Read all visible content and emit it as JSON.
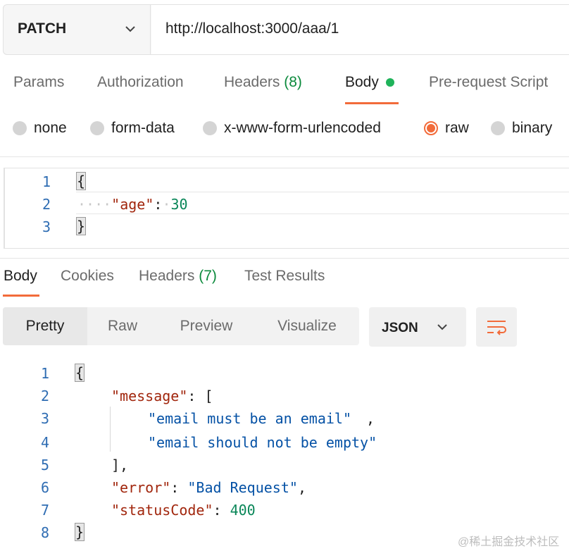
{
  "request": {
    "method": "PATCH",
    "method_icon": "chevron-down-icon",
    "url": "http://localhost:3000/aaa/1"
  },
  "request_tabs": {
    "params": "Params",
    "authorization": "Authorization",
    "headers_label": "Headers",
    "headers_count": "(8)",
    "body": "Body",
    "prerequest": "Pre-request Script"
  },
  "body_types": {
    "none": "none",
    "form_data": "form-data",
    "urlencoded": "x-www-form-urlencoded",
    "raw": "raw",
    "binary": "binary",
    "selected": "raw"
  },
  "request_body": {
    "lines": [
      "1",
      "2",
      "3"
    ],
    "open_brace": "{",
    "key": "\"age\"",
    "colon": ":",
    "value": "30",
    "close_brace": "}",
    "indent_marks": "····",
    "space_mark": "·"
  },
  "response_tabs": {
    "body": "Body",
    "cookies": "Cookies",
    "headers_label": "Headers",
    "headers_count": "(7)",
    "test_results": "Test Results"
  },
  "view_modes": {
    "pretty": "Pretty",
    "raw": "Raw",
    "preview": "Preview",
    "visualize": "Visualize",
    "format": "JSON",
    "wrap_icon": "wrap-lines-icon"
  },
  "response_body": {
    "lines": [
      "1",
      "2",
      "3",
      "4",
      "5",
      "6",
      "7",
      "8"
    ],
    "open_brace": "{",
    "message_key": "\"message\"",
    "message_open": ": [",
    "msg1": "\"email must be an email\"",
    "msg2": "\"email should not be empty\"",
    "array_close": "],",
    "error_key": "\"error\"",
    "error_value": "\"Bad Request\"",
    "status_key": "\"statusCode\"",
    "status_value": "400",
    "close_brace": "}"
  },
  "watermark": "@稀土掘金技术社区",
  "colors": {
    "accent": "#f26b3a",
    "status_green": "#1fb35a",
    "key": "#a1260d",
    "string": "#0451a5",
    "number": "#098658"
  }
}
